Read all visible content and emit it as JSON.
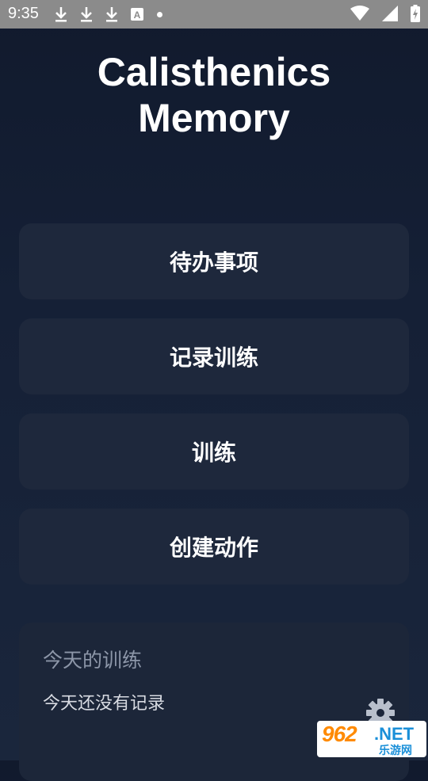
{
  "status_bar": {
    "time": "9:35",
    "left_icons": [
      "download-icon",
      "download-icon",
      "download-icon",
      "a-notification-icon",
      "dot-icon"
    ],
    "right_icons": [
      "wifi-icon",
      "signal-icon",
      "battery-charging-icon"
    ]
  },
  "app": {
    "title_line1": "Calisthenics",
    "title_line2": "Memory"
  },
  "menu": {
    "todo": "待办事项",
    "record_training": "记录训练",
    "training": "训练",
    "create_action": "创建动作"
  },
  "today": {
    "title": "今天的训练",
    "empty_text": "今天还没有记录"
  },
  "watermark": {
    "number": "962",
    "net": ".NET",
    "sub": "乐游网"
  },
  "colors": {
    "background": "#131c30",
    "card": "#1e283c",
    "muted_text": "#8c96a8",
    "watermark_orange": "#ff8a00",
    "watermark_blue": "#1a8fd8"
  }
}
